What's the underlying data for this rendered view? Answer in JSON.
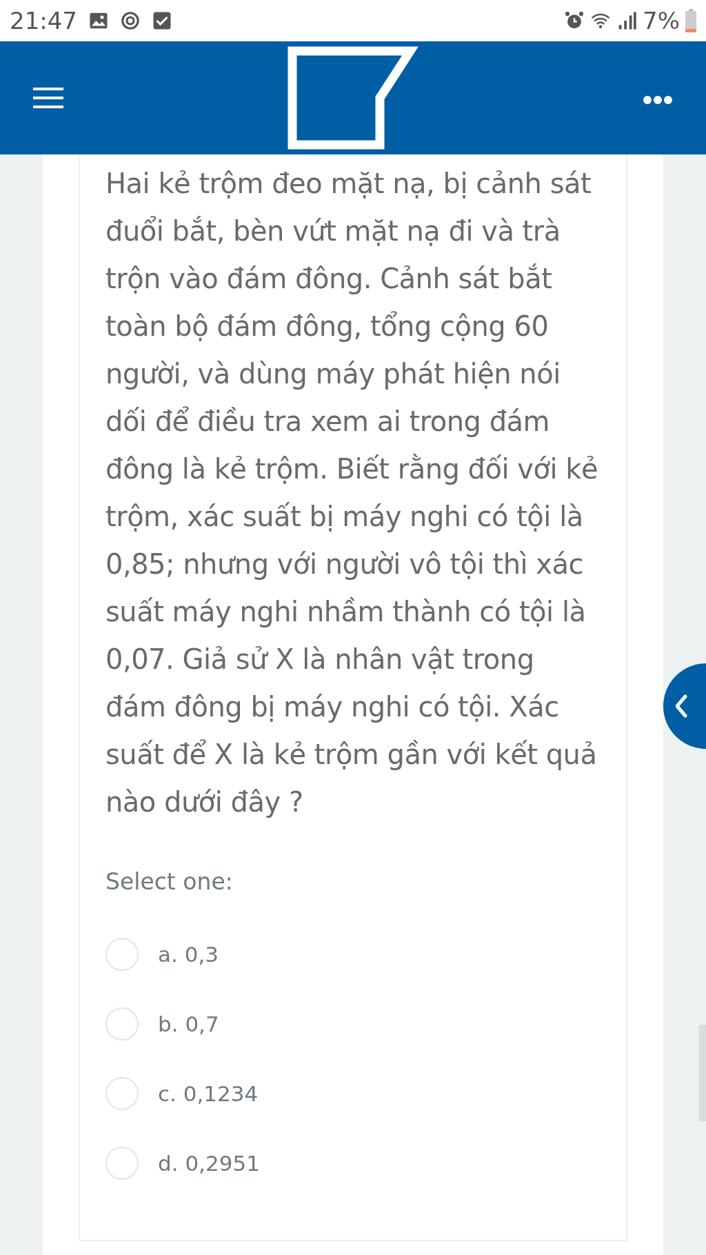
{
  "status_bar": {
    "time": "21:47",
    "battery": "7%"
  },
  "question": {
    "text": "Hai kẻ trộm đeo mặt nạ, bị cảnh sát đuổi bắt, bèn vứt mặt nạ đi và trà trộn vào đám đông. Cảnh sát bắt toàn bộ đám đông, tổng cộng 60 người, và dùng máy phát hiện nói dối để điều tra xem ai trong đám đông là kẻ trộm. Biết rằng đối với kẻ trộm, xác suất bị máy nghi có tội là 0,85; nhưng với người vô tội thì xác suất máy nghi nhầm thành có tội là 0,07. Giả sử X là nhân vật trong đám đông bị máy nghi có tội. Xác suất để X là kẻ trộm gần với kết quả nào dưới đây ?",
    "prompt": "Select one:",
    "options": [
      {
        "label": "a. 0,3",
        "selected": false
      },
      {
        "label": "b. 0,7",
        "selected": false
      },
      {
        "label": "c. 0,1234",
        "selected": false
      },
      {
        "label": "d. 0,2951",
        "selected": false
      }
    ]
  }
}
